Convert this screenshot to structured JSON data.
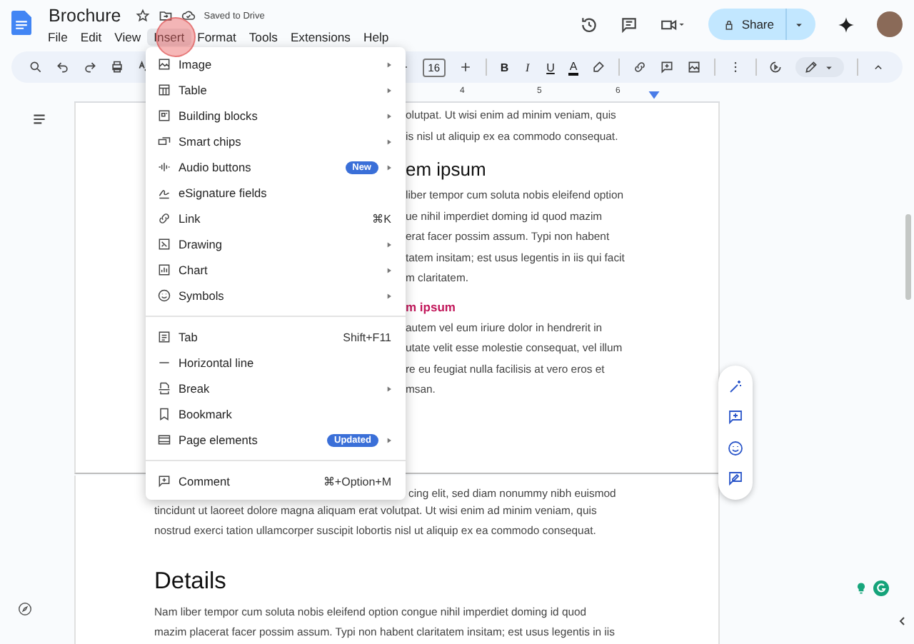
{
  "document": {
    "title": "Brochure",
    "save_status": "Saved to Drive"
  },
  "menu_bar": [
    {
      "label": "File",
      "selected": false
    },
    {
      "label": "Edit",
      "selected": false
    },
    {
      "label": "View",
      "selected": false
    },
    {
      "label": "Insert",
      "selected": true
    },
    {
      "label": "Format",
      "selected": false
    },
    {
      "label": "Tools",
      "selected": false
    },
    {
      "label": "Extensions",
      "selected": false
    },
    {
      "label": "Help",
      "selected": false
    }
  ],
  "share_button": {
    "label": "Share"
  },
  "toolbar": {
    "font_size": "16",
    "format_buttons": [
      "B",
      "I",
      "U",
      "A"
    ]
  },
  "ruler": {
    "numbers": [
      "4",
      "5",
      "6"
    ]
  },
  "insert_menu": {
    "groups": [
      [
        {
          "label": "Image",
          "submenu": true
        },
        {
          "label": "Table",
          "submenu": true
        },
        {
          "label": "Building blocks",
          "submenu": true
        },
        {
          "label": "Smart chips",
          "submenu": true
        },
        {
          "label": "Audio buttons",
          "badge": "New",
          "submenu": true
        },
        {
          "label": "eSignature fields",
          "submenu": false
        },
        {
          "label": "Link",
          "shortcut": "⌘K",
          "submenu": false
        },
        {
          "label": "Drawing",
          "submenu": true
        },
        {
          "label": "Chart",
          "submenu": true
        },
        {
          "label": "Symbols",
          "submenu": true
        }
      ],
      [
        {
          "label": "Tab",
          "shortcut": "Shift+F11",
          "submenu": false
        },
        {
          "label": "Horizontal line",
          "submenu": false
        },
        {
          "label": "Break",
          "submenu": true
        },
        {
          "label": "Bookmark",
          "submenu": false
        },
        {
          "label": "Page elements",
          "badge": "Updated",
          "submenu": true
        }
      ],
      [
        {
          "label": "Comment",
          "shortcut": "⌘+Option+M",
          "submenu": false
        }
      ]
    ]
  },
  "page_1": [
    {
      "kind": "paragraph",
      "lines": [
        "olutpat. Ut wisi enim ad minim veniam, quis",
        "is nisl ut aliquip ex ea commodo consequat."
      ]
    },
    {
      "kind": "heading",
      "text": "em ipsum"
    },
    {
      "kind": "paragraph",
      "lines": [
        "liber tempor cum soluta nobis eleifend option",
        "ue nihil imperdiet doming id quod mazim",
        "erat facer possim assum. Typi non habent",
        "tatem insitam; est usus legentis in iis qui facit",
        "m claritatem."
      ]
    },
    {
      "kind": "subheading",
      "text": "m ipsum"
    },
    {
      "kind": "paragraph",
      "lines": [
        "autem vel eum iriure dolor in hendrerit in",
        "utate velit esse molestie consequat, vel illum",
        "re eu feugiat nulla facilisis at vero eros et",
        "msan."
      ]
    }
  ],
  "page_2": [
    {
      "kind": "fragment",
      "lines": [
        "cing elit, sed diam nonummy nibh euismod"
      ]
    },
    {
      "kind": "paragraph",
      "lines": [
        "tincidunt ut laoreet dolore magna aliquam erat volutpat. Ut wisi enim ad minim veniam, quis",
        "nostrud exerci tation ullamcorper suscipit lobortis nisl ut aliquip ex ea commodo consequat."
      ]
    },
    {
      "kind": "title",
      "text": "Details"
    },
    {
      "kind": "paragraph",
      "lines": [
        "Nam liber tempor cum soluta nobis eleifend option congue nihil imperdiet doming id quod",
        "mazim placerat facer possim assum. Typi non habent claritatem insitam; est usus legentis in iis"
      ]
    }
  ]
}
